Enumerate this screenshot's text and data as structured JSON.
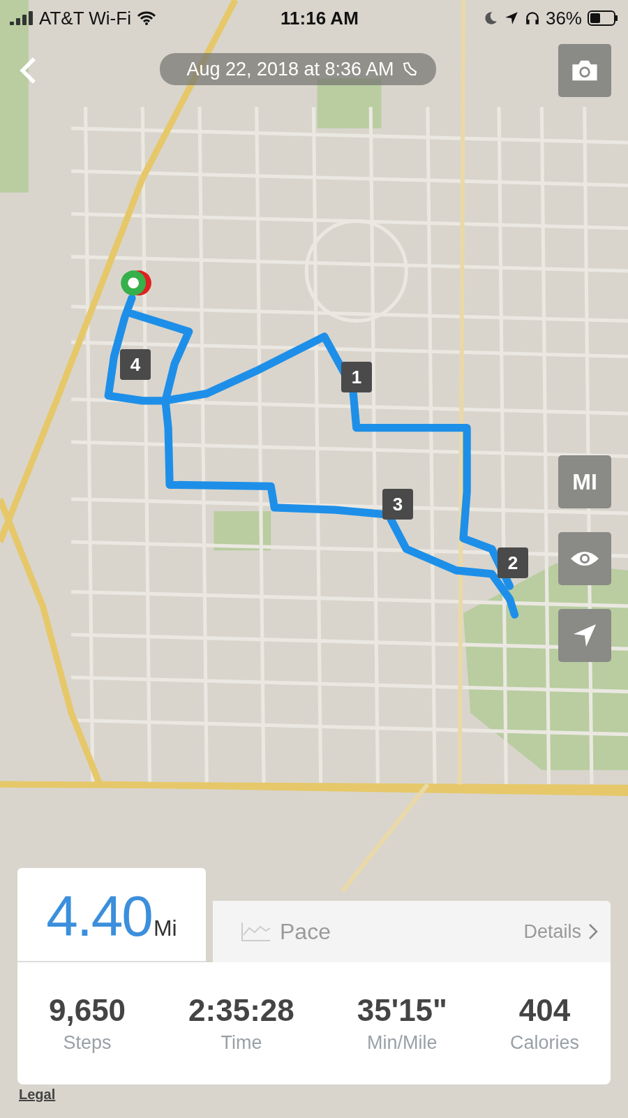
{
  "status_bar": {
    "carrier": "AT&T Wi-Fi",
    "time": "11:16 AM",
    "battery": "36%"
  },
  "header": {
    "title": "Aug 22, 2018 at 8:36 AM"
  },
  "units_button": "MI",
  "route_markers": [
    {
      "label": "1"
    },
    {
      "label": "2"
    },
    {
      "label": "3"
    },
    {
      "label": "4"
    }
  ],
  "summary": {
    "tabs": [
      {
        "kind": "distance",
        "value": "4.40",
        "unit": "Mi",
        "selected": true
      },
      {
        "kind": "chart",
        "label": "Pace",
        "selected": false
      }
    ],
    "details_link": "Details",
    "stats": [
      {
        "value": "9,650",
        "label": "Steps"
      },
      {
        "value": "2:35:28",
        "label": "Time"
      },
      {
        "value": "35'15\"",
        "label": "Min/Mile"
      },
      {
        "value": "404",
        "label": "Calories"
      }
    ]
  },
  "legal": "Legal"
}
